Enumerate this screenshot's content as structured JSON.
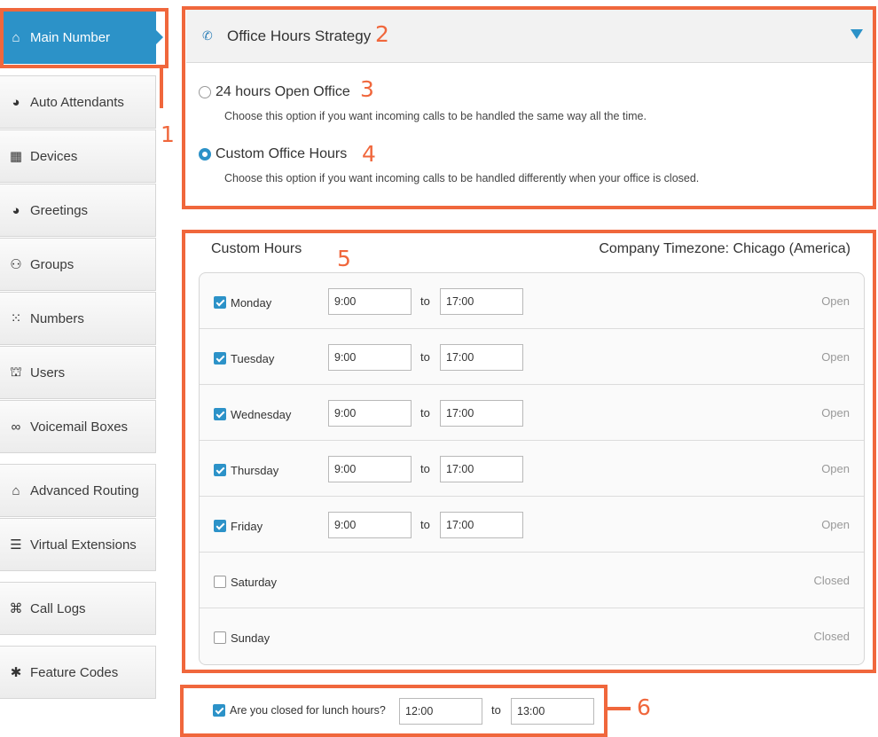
{
  "sidebar": {
    "items": [
      {
        "label": "Main Number",
        "icon": "home-icon",
        "glyph": "⌂"
      },
      {
        "label": "Auto Attendants",
        "icon": "speaker-head-icon",
        "glyph": "◕"
      },
      {
        "label": "Devices",
        "icon": "phone-device-icon",
        "glyph": "▦"
      },
      {
        "label": "Greetings",
        "icon": "speaker-head-icon",
        "glyph": "◕"
      },
      {
        "label": "Groups",
        "icon": "group-icon",
        "glyph": "⚇"
      },
      {
        "label": "Numbers",
        "icon": "keypad-icon",
        "glyph": "⁙"
      },
      {
        "label": "Users",
        "icon": "users-desk-icon",
        "glyph": "⛫"
      },
      {
        "label": "Voicemail Boxes",
        "icon": "voicemail-icon",
        "glyph": "∞"
      },
      {
        "label": "Advanced Routing",
        "icon": "home-icon",
        "glyph": "⌂"
      },
      {
        "label": "Virtual Extensions",
        "icon": "list-icon",
        "glyph": "☰"
      },
      {
        "label": "Call Logs",
        "icon": "network-icon",
        "glyph": "⌘"
      },
      {
        "label": "Feature Codes",
        "icon": "asterisk-icon",
        "glyph": "✱"
      }
    ]
  },
  "strategy": {
    "title": "Office Hours Strategy",
    "phone_glyph": "✆",
    "options": [
      {
        "label": "24 hours Open Office",
        "description": "Choose this option if you want incoming calls to be handled the same way all the time.",
        "selected": false
      },
      {
        "label": "Custom Office Hours",
        "description": "Choose this option if you want incoming calls to be handled differently when your office is closed.",
        "selected": true
      }
    ]
  },
  "custom_hours": {
    "title": "Custom Hours",
    "timezone": "Company Timezone: Chicago (America)",
    "to_label": "to",
    "days": [
      {
        "name": "Monday",
        "checked": true,
        "start": "9:00",
        "end": "17:00",
        "status": "Open"
      },
      {
        "name": "Tuesday",
        "checked": true,
        "start": "9:00",
        "end": "17:00",
        "status": "Open"
      },
      {
        "name": "Wednesday",
        "checked": true,
        "start": "9:00",
        "end": "17:00",
        "status": "Open"
      },
      {
        "name": "Thursday",
        "checked": true,
        "start": "9:00",
        "end": "17:00",
        "status": "Open"
      },
      {
        "name": "Friday",
        "checked": true,
        "start": "9:00",
        "end": "17:00",
        "status": "Open"
      },
      {
        "name": "Saturday",
        "checked": false,
        "start": "",
        "end": "",
        "status": "Closed"
      },
      {
        "name": "Sunday",
        "checked": false,
        "start": "",
        "end": "",
        "status": "Closed"
      }
    ]
  },
  "lunch": {
    "label": "Are you closed for lunch hours?",
    "checked": true,
    "start": "12:00",
    "to_label": "to",
    "end": "13:00"
  },
  "annotations": [
    "1",
    "2",
    "3",
    "4",
    "5",
    "6"
  ],
  "colors": {
    "accent": "#2c92c8",
    "annotation": "#f0673c"
  }
}
